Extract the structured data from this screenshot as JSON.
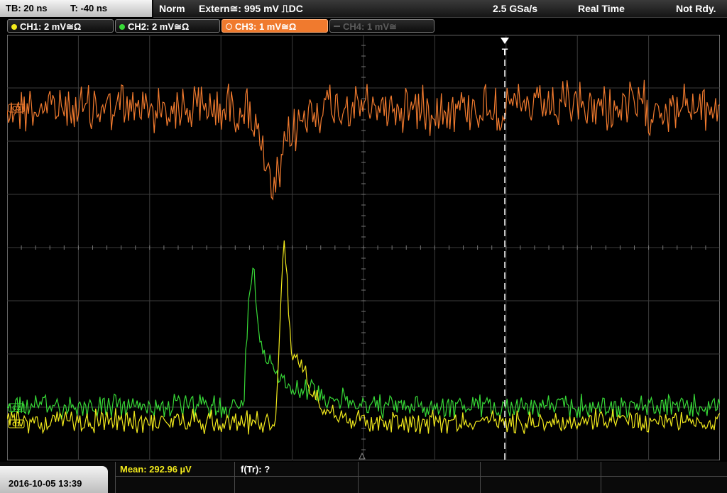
{
  "header": {
    "tb": "TB: 20 ns",
    "t": "T: -40 ns",
    "mode": "Norm",
    "source": "Extern≅: 995 mV ⎍DC",
    "sample_rate": "2.5 GSa/s",
    "acq_mode": "Real Time",
    "status": "Not Rdy."
  },
  "channels": [
    {
      "label": "CH1: 2 mV≅Ω",
      "color": "#f2ea1c",
      "state": "on"
    },
    {
      "label": "CH2: 2 mV≅Ω",
      "color": "#37d937",
      "state": "on"
    },
    {
      "label": "CH3: 1 mV≅Ω",
      "color": "#f07a2e",
      "state": "active"
    },
    {
      "label": "CH4: 1 mV≅",
      "color": "#5c5c5c",
      "state": "off"
    }
  ],
  "markers": {
    "trigger": "T",
    "ch3": "C3",
    "ch2": "C2",
    "ch1": "C1"
  },
  "footer": {
    "datetime": "2016-10-05 13:39",
    "measurement": "Mean: 292.96 µV",
    "freq": "f(Tr): ?"
  },
  "colors": {
    "ch1": "#f2ea1c",
    "ch2": "#37d937",
    "ch3": "#f07a2e",
    "grid": "#3c3c3c"
  }
}
